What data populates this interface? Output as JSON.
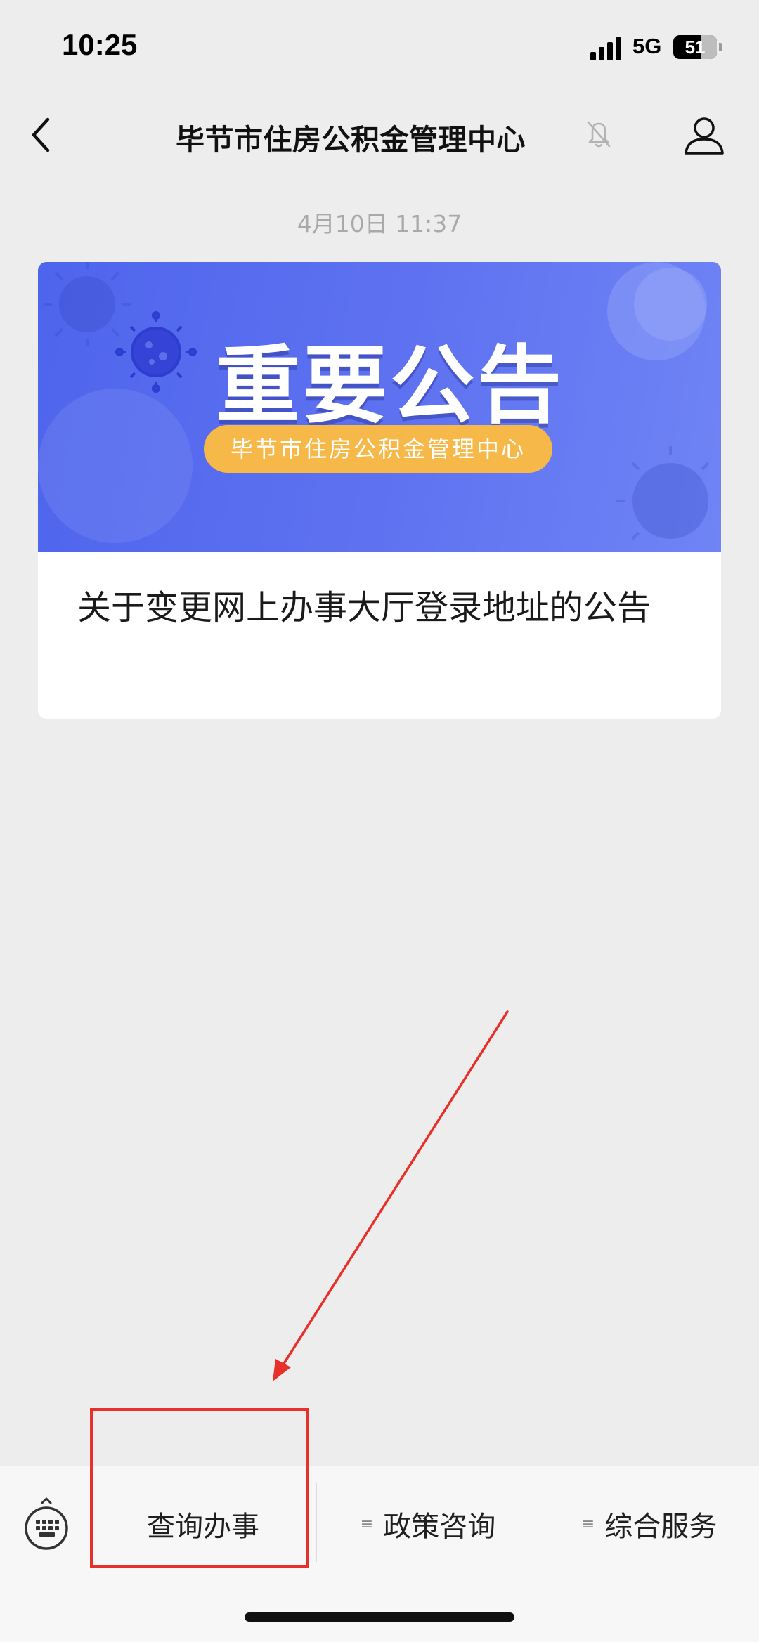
{
  "status_bar": {
    "time": "10:25",
    "network": "5G",
    "battery": "51"
  },
  "nav": {
    "title": "毕节市住房公积金管理中心",
    "back_icon": "chevron-left-icon",
    "mute_icon": "bell-muted-icon",
    "profile_icon": "person-icon"
  },
  "conversation": {
    "timestamp": "4月10日 11:37"
  },
  "article": {
    "banner_heading": "重要公告",
    "banner_subtitle": "毕节市住房公积金管理中心",
    "title": "关于变更网上办事大厅登录地址的公告",
    "banner_color": "#5468ee",
    "pill_color": "#f7b84a"
  },
  "menu": {
    "keyboard_icon": "keyboard-icon",
    "items": [
      {
        "label": "查询办事",
        "has_submenu_icon": false
      },
      {
        "label": "政策咨询",
        "has_submenu_icon": true
      },
      {
        "label": "综合服务",
        "has_submenu_icon": true
      }
    ],
    "submenu_icon": "≡"
  },
  "annotation": {
    "color": "#e8302a"
  }
}
